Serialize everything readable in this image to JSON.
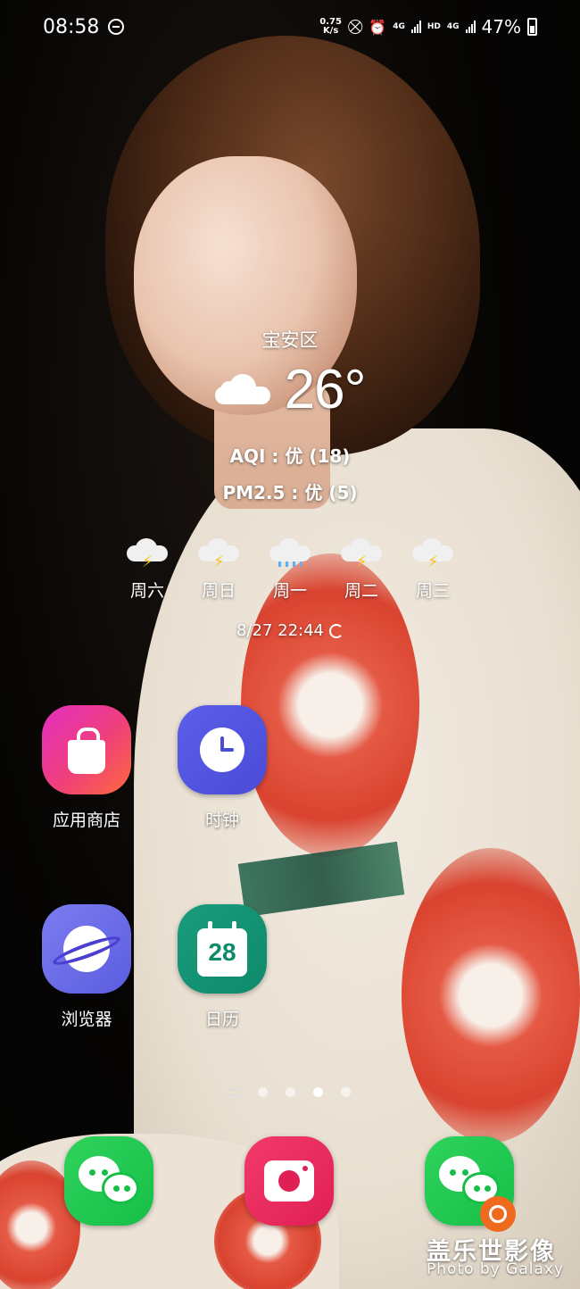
{
  "status_bar": {
    "time": "08:58",
    "net_speed_value": "0.75",
    "net_speed_unit": "K/s",
    "network_1": "4G",
    "hd": "HD",
    "network_2": "4G",
    "battery": "47%",
    "battery_level": 0.47
  },
  "weather": {
    "location": "宝安区",
    "temperature": "26°",
    "condition_icon": "cloud-icon",
    "aqi": "AQI : 优 (18)",
    "pm25": "PM2.5 : 优 (5)",
    "forecast": [
      {
        "day": "周六",
        "icon": "thunderstorm-icon"
      },
      {
        "day": "周日",
        "icon": "thunderstorm-icon"
      },
      {
        "day": "周一",
        "icon": "rain-icon"
      },
      {
        "day": "周二",
        "icon": "thunderstorm-icon"
      },
      {
        "day": "周三",
        "icon": "thunderstorm-icon"
      }
    ],
    "updated": "8/27 22:44"
  },
  "apps": {
    "store": "应用商店",
    "clock": "时钟",
    "browser": "浏览器",
    "calendar": "日历",
    "calendar_day": "28"
  },
  "page_indicator": {
    "pages": 4,
    "active": 3
  },
  "watermark": {
    "title": "盖乐世影像",
    "subtitle": "Photo by Galaxy"
  },
  "colors": {
    "store": "#e22ec1",
    "clock": "#4a4cd6",
    "browser": "#5a5de0",
    "calendar": "#0d8a6a",
    "wechat": "#16be48",
    "camera": "#e01f55"
  }
}
